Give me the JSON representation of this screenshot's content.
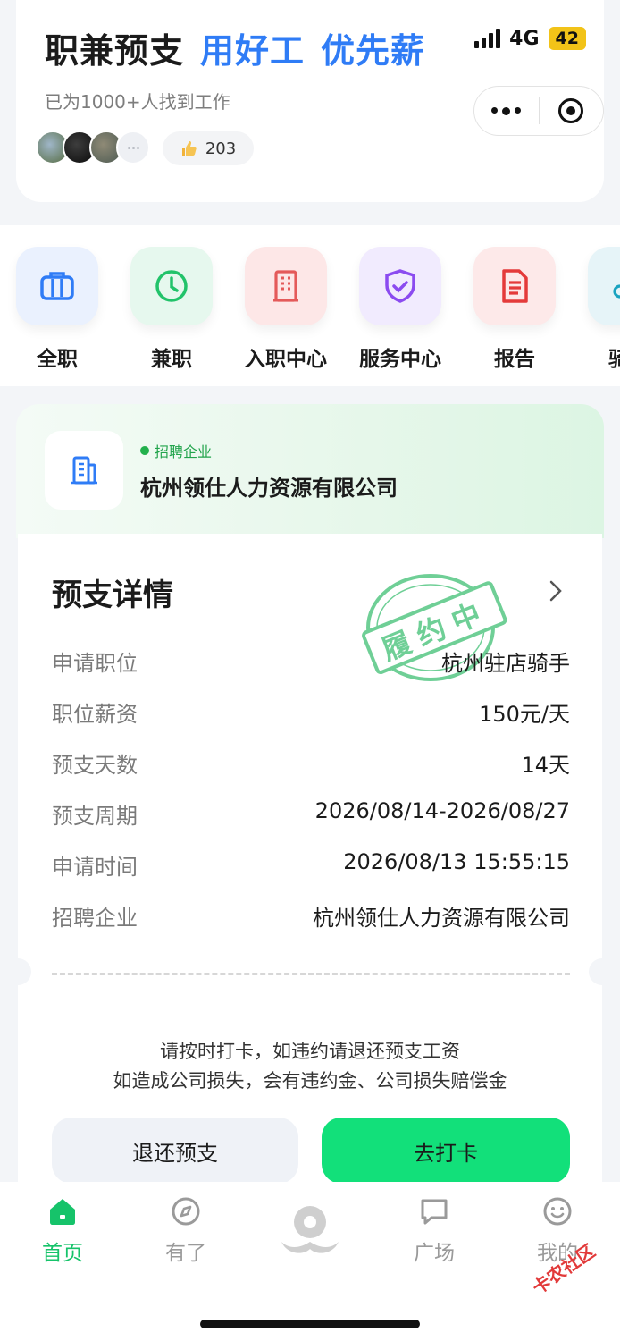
{
  "status_bar": {
    "network": "4G",
    "battery": "42"
  },
  "header": {
    "title_part1": "职兼预支",
    "title_part2": "用好工",
    "title_part3": "优先薪",
    "subtitle": "已为1000+人找到工作",
    "likes": "203"
  },
  "categories": [
    {
      "label": "全职",
      "icon": "briefcase-icon",
      "color": "#2f7cf6"
    },
    {
      "label": "兼职",
      "icon": "clock-icon",
      "color": "#22c36a"
    },
    {
      "label": "入职中心",
      "icon": "building-icon",
      "color": "#e45a5a"
    },
    {
      "label": "服务中心",
      "icon": "shield-check-icon",
      "color": "#8b4bf0"
    },
    {
      "label": "报告",
      "icon": "document-icon",
      "color": "#e43a3a"
    },
    {
      "label": "骑手",
      "icon": "rider-icon",
      "color": "#1aa3c0"
    }
  ],
  "company": {
    "tag": "招聘企业",
    "name": "杭州领仕人力资源有限公司"
  },
  "details": {
    "title": "预支详情",
    "stamp_text": "履约中",
    "rows": [
      {
        "key": "申请职位",
        "value": "杭州驻店骑手"
      },
      {
        "key": "职位薪资",
        "value": "150元/天"
      },
      {
        "key": "预支天数",
        "value": "14天"
      },
      {
        "key": "预支周期",
        "value": "2026/08/14-2026/08/27"
      },
      {
        "key": "申请时间",
        "value": "2026/08/13 15:55:15"
      },
      {
        "key": "招聘企业",
        "value": "杭州领仕人力资源有限公司"
      }
    ],
    "notice_line1": "请按时打卡，如违约请退还预支工资",
    "notice_line2": "如造成公司损失，会有违约金、公司损失赔偿金",
    "btn_return": "退还预支",
    "btn_clock": "去打卡"
  },
  "nav": [
    {
      "label": "首页",
      "icon": "home-icon",
      "active": true
    },
    {
      "label": "有了",
      "icon": "compass-icon",
      "active": false
    },
    {
      "label": "",
      "icon": "center-logo-icon",
      "active": false
    },
    {
      "label": "广场",
      "icon": "chat-bubble-icon",
      "active": false
    },
    {
      "label": "我的",
      "icon": "smiley-icon",
      "active": false
    }
  ],
  "watermark": "卡农社区",
  "colors": {
    "accent_blue": "#2f7cf6",
    "accent_green": "#12e07a",
    "active_tab": "#16c36a"
  }
}
